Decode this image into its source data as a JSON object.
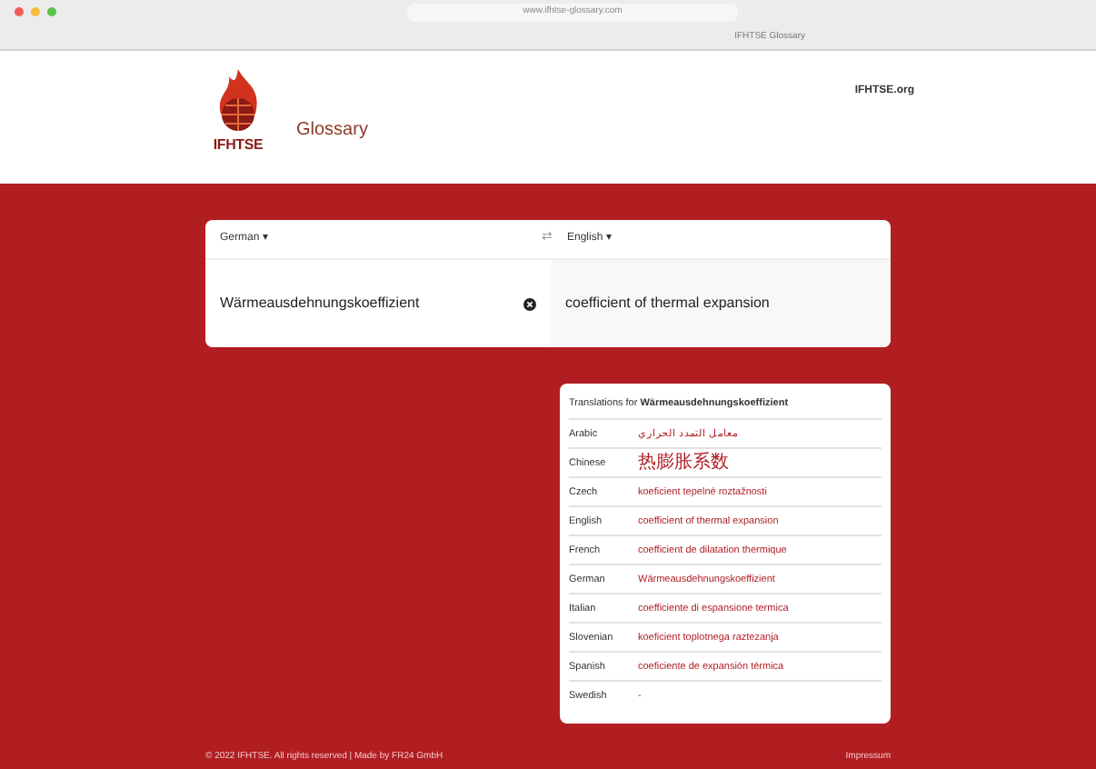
{
  "browser": {
    "url": "www.ifhtse-glossary.com",
    "tab_title": "IFHTSE Glossary"
  },
  "header": {
    "logo_text": "IFHTSE",
    "title": "Glossary",
    "link": "IFHTSE.org"
  },
  "translator": {
    "source_language": "German ▾",
    "target_language": "English ▾",
    "swap": "⇄",
    "source_term": "Wärmeausdehnungskoeffizient",
    "target_term": "coefficient of thermal expansion"
  },
  "translations": {
    "heading": "Translations for **Wärmeausdehnungskoeffizient**",
    "rows": [
      {
        "language": "Arabic",
        "term": "معامل التمدد الحراري"
      },
      {
        "language": "Chinese",
        "term": "热膨胀系数"
      },
      {
        "language": "Czech",
        "term": "koeficient tepelné roztažnosti"
      },
      {
        "language": "English",
        "term": "coefficient of thermal expansion"
      },
      {
        "language": "French",
        "term": "coefficient de dilatation thermique"
      },
      {
        "language": "German",
        "term": "Wärmeausdehnungskoeffizient"
      },
      {
        "language": "Italian",
        "term": "coefficiente di espansione termica"
      },
      {
        "language": "Slovenian",
        "term": "koeficient toplotnega raztezanja"
      },
      {
        "language": "Spanish",
        "term": "coeficiente de expansión térmica"
      },
      {
        "language": "Swedish",
        "term": "-"
      }
    ]
  },
  "footer": {
    "copyright": "© 2022 IFHTSE. All rights reserved | Made by FR24 GmbH",
    "link": "Impressum"
  }
}
